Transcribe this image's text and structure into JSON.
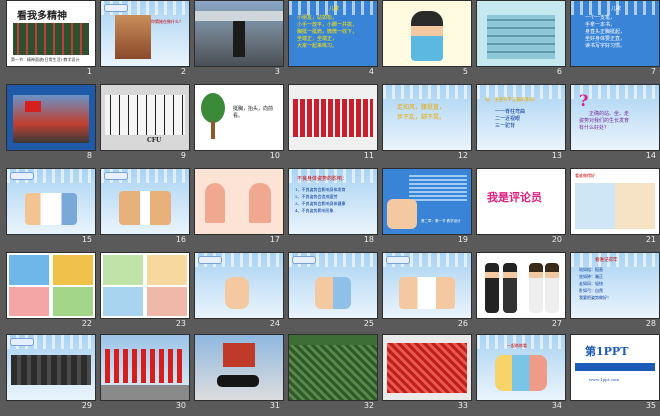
{
  "slides": [
    {
      "num": "1",
      "title": "看我多精神",
      "footer": "第一节：精神面貌(日常生活) 教学设计"
    },
    {
      "num": "2",
      "label": "左图课件",
      "caption": "你猜她在做什么？"
    },
    {
      "num": "3"
    },
    {
      "num": "4",
      "heading": "儿歌",
      "lines": [
        "小朋友，站如松，",
        "小手一放平，小脚一并拢，",
        "胸挺一挺肩，微微一收下，",
        "坐端正，坐端正，",
        "大家一起来练习。"
      ]
    },
    {
      "num": "5"
    },
    {
      "num": "6"
    },
    {
      "num": "7",
      "heading": "儿歌",
      "lines": [
        "一个一支笔，",
        "手拿一本书，",
        "身直头正胸挺起，",
        "坐好身体要正直，",
        "读书写字好习惯。"
      ]
    },
    {
      "num": "8",
      "label": "升旗仪式"
    },
    {
      "num": "9",
      "logo": "CFU"
    },
    {
      "num": "10",
      "caption": "挺胸，抬头，向前看。"
    },
    {
      "num": "11"
    },
    {
      "num": "12",
      "lines": [
        "走如风，腰挺直，",
        "步不乱，脚不晃。"
      ]
    },
    {
      "num": "13",
      "heading": "站、坐姿势不正确的影响",
      "lines": [
        "一一脊柱弯曲",
        "二一近视眼",
        "三一驼背"
      ]
    },
    {
      "num": "14",
      "mark": "?",
      "lines": [
        "正确的站、坐、走",
        "姿势对我们的生长发育",
        "有什么好处？"
      ]
    },
    {
      "num": "15",
      "label": "课件展示"
    },
    {
      "num": "16",
      "label": "课件展示"
    },
    {
      "num": "17"
    },
    {
      "num": "18",
      "heading": "不良身体姿势的影响：",
      "lines": [
        "1、不良姿势会影响身体发育",
        "2、不良姿势会造成疲劳",
        "3、不良姿势会影响身体健康",
        "4、不良姿势影响形象"
      ]
    },
    {
      "num": "19",
      "lines": [
        "第二章：第一节 教学设计"
      ]
    },
    {
      "num": "20",
      "caption": "我是评论员"
    },
    {
      "num": "21",
      "caption": "看谁做得好"
    },
    {
      "num": "22"
    },
    {
      "num": "23"
    },
    {
      "num": "24",
      "label": "课件展示"
    },
    {
      "num": "25",
      "label": "课件展示"
    },
    {
      "num": "26",
      "label": "课件展示"
    },
    {
      "num": "27"
    },
    {
      "num": "28",
      "heading": "看谁记得牢",
      "lines": [
        "站如松：挺直",
        "坐如钟：端正",
        "走如风：轻快",
        "卧如弓：自然",
        "我要把姿势做好！"
      ]
    },
    {
      "num": "29",
      "label": "阅兵"
    },
    {
      "num": "30"
    },
    {
      "num": "31"
    },
    {
      "num": "32",
      "label": "阅兵方阵"
    },
    {
      "num": "33"
    },
    {
      "num": "34",
      "caption": "一起练练看"
    },
    {
      "num": "35",
      "logo": "第1PPT",
      "lines": [
        "www.1ppt.com"
      ]
    }
  ],
  "colors": {
    "background": "#5a5a5a",
    "slide_border": "#2e2e2e",
    "text_blue": "#003399",
    "title_yellow": "#e6a800"
  }
}
